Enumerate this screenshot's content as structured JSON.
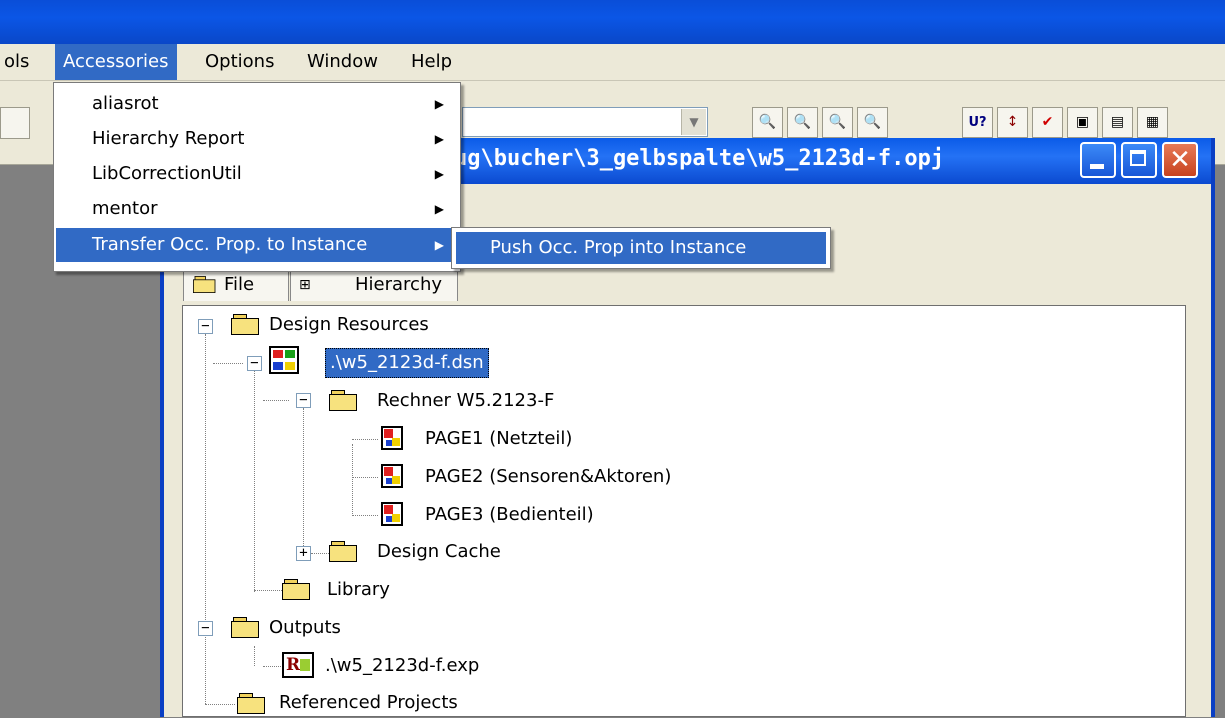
{
  "menubar": {
    "items": [
      "ols",
      "Accessories",
      "Options",
      "Window",
      "Help"
    ]
  },
  "accessories_menu": {
    "items": [
      {
        "label": "aliasrot",
        "has_submenu": true
      },
      {
        "label": "Hierarchy Report",
        "has_submenu": true
      },
      {
        "label": "LibCorrectionUtil",
        "has_submenu": true
      },
      {
        "label": "mentor",
        "has_submenu": true
      },
      {
        "label": "Transfer Occ. Prop. to Instance",
        "has_submenu": true
      }
    ],
    "submenu": {
      "items": [
        "Push Occ. Prop into Instance"
      ]
    }
  },
  "toolbar": {
    "combo_value": "",
    "icons": [
      "zoom-in-icon",
      "zoom-out-icon",
      "zoom-area-icon",
      "zoom-all-icon",
      "part-reference-icon",
      "annotate-icon",
      "drc-icon",
      "cross-reference-icon",
      "bill-of-materials-icon",
      "netlist-icon"
    ]
  },
  "project_window": {
    "title": "ug\\bucher\\3_gelbspalte\\w5_2123d-f.opj",
    "tabs": [
      "File",
      "Hierarchy"
    ]
  },
  "tree": {
    "design_resources": "Design Resources",
    "dsn_file": ".\\w5_2123d-f.dsn",
    "schematic": "Rechner W5.2123-F",
    "pages": [
      "PAGE1 (Netzteil)",
      "PAGE2 (Sensoren&Aktoren)",
      "PAGE3 (Bedienteil)"
    ],
    "design_cache": "Design Cache",
    "library": "Library",
    "outputs": "Outputs",
    "exp_file": ".\\w5_2123d-f.exp",
    "referenced_projects": "Referenced Projects"
  },
  "colors": {
    "menu_highlight": "#316ac5",
    "title_blue": "#0b5be8",
    "chrome": "#ece9d8"
  }
}
